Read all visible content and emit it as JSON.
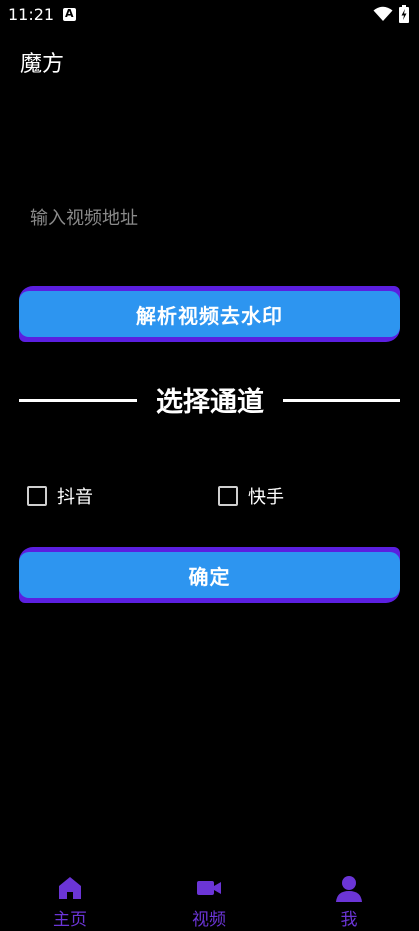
{
  "status_bar": {
    "time": "11:21"
  },
  "app_bar": {
    "title": "魔方"
  },
  "input": {
    "placeholder": "输入视频地址",
    "value": ""
  },
  "parse_button": {
    "label": "解析视频去水印"
  },
  "section": {
    "title": "选择通道"
  },
  "channels": [
    {
      "label": "抖音",
      "checked": false
    },
    {
      "label": "快手",
      "checked": false
    }
  ],
  "confirm_button": {
    "label": "确定"
  },
  "bottom_nav": {
    "items": [
      {
        "label": "主页",
        "icon": "home-icon"
      },
      {
        "label": "视频",
        "icon": "video-camera-icon"
      },
      {
        "label": "我",
        "icon": "person-icon"
      }
    ]
  },
  "colors": {
    "background": "#000000",
    "button_face": "#2d95f0",
    "button_edge": "#5b1fe0",
    "nav_accent": "#6b35d6"
  }
}
